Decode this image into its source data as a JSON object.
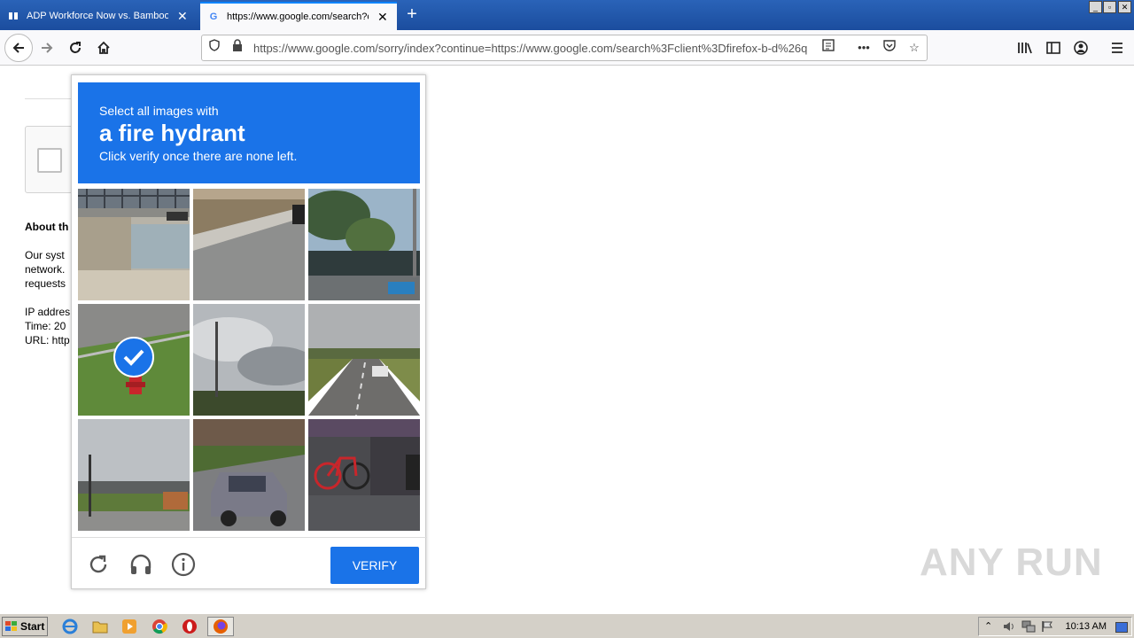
{
  "browser": {
    "tabs": [
      {
        "title": "ADP Workforce Now vs. BambooH",
        "favicon": "book-icon"
      },
      {
        "title": "https://www.google.com/search?c",
        "favicon": "google-icon"
      }
    ],
    "url": "https://www.google.com/sorry/index?continue=https://www.google.com/search%3Fclient%3Dfirefox-b-d%26q"
  },
  "background": {
    "about_heading": "About th",
    "para1": [
      "Our syst",
      "network.",
      "requests"
    ],
    "para2": [
      "IP addres",
      "Time: 20",
      "URL: http"
    ]
  },
  "captcha": {
    "instruction": "Select all images with",
    "target": "a fire hydrant",
    "hint": "Click verify once there are none left.",
    "selected_tiles": [
      3
    ],
    "verify_label": "VERIFY",
    "accent_color": "#1a73e8"
  },
  "watermark": "ANY RUN",
  "taskbar": {
    "start_label": "Start",
    "clock": "10:13 AM"
  }
}
